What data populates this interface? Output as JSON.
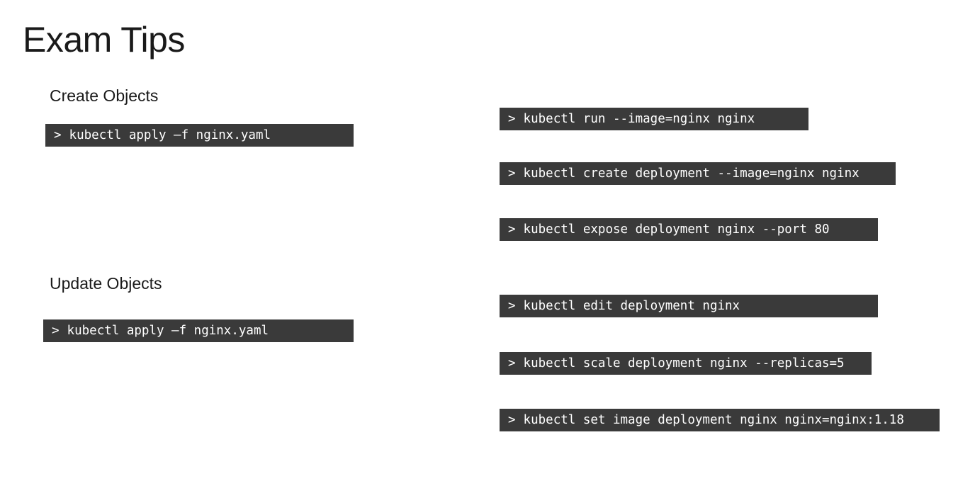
{
  "slide": {
    "title": "Exam Tips"
  },
  "sections": {
    "create": {
      "heading": "Create Objects",
      "command": "kubectl apply –f nginx.yaml"
    },
    "update": {
      "heading": "Update Objects",
      "command": "kubectl apply –f nginx.yaml"
    }
  },
  "prompt_symbol": ">",
  "imperative_commands": [
    "kubectl run --image=nginx nginx",
    "kubectl create deployment --image=nginx nginx",
    "kubectl expose deployment nginx --port 80",
    "kubectl edit deployment nginx",
    "kubectl scale deployment nginx --replicas=5",
    "kubectl set image deployment nginx nginx=nginx:1.18"
  ],
  "colors": {
    "command_background": "#3a3a3a",
    "command_text": "#ffffff",
    "title_text": "#1a1a1a"
  }
}
